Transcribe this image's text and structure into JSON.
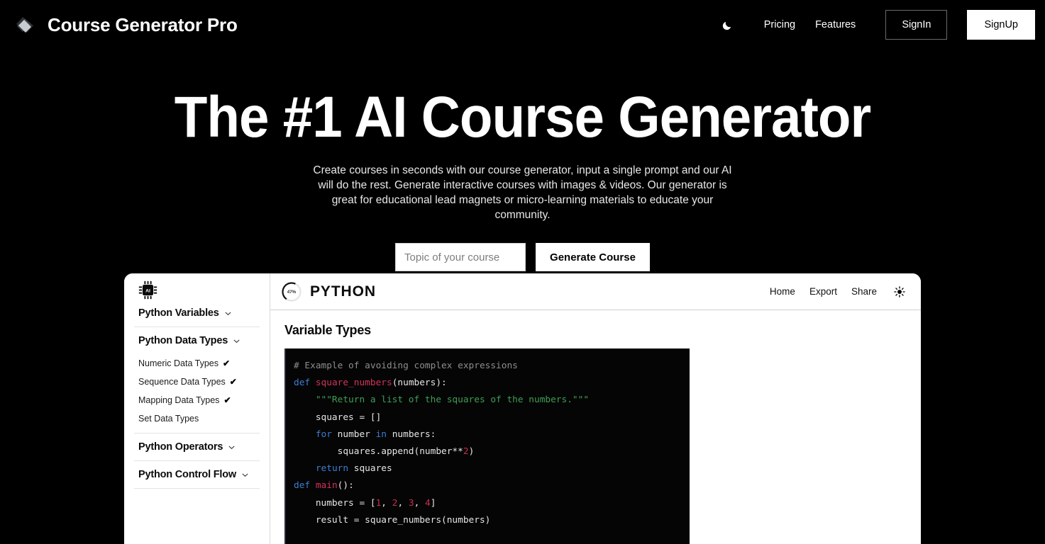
{
  "topnav": {
    "brand": "Course Generator Pro",
    "theme_icon": "moon-icon",
    "links": [
      "Pricing",
      "Features"
    ],
    "signin_label": "SignIn",
    "signup_label": "SignUp"
  },
  "hero": {
    "title": "The #1 AI Course Generator",
    "subtitle": "Create courses in seconds with our course generator, input a single prompt and our AI will do the rest. Generate interactive courses with images & videos. Our generator is great for educational lead magnets or micro-learning materials to educate your community.",
    "input_placeholder": "Topic of your course",
    "input_value": "",
    "generate_label": "Generate Course"
  },
  "preview": {
    "sidebar": {
      "logo_icon": "ai-chip-icon",
      "groups": [
        {
          "label": "Python Variables",
          "items": []
        },
        {
          "label": "Python Data Types",
          "items": [
            {
              "label": "Numeric Data Types",
              "done": true,
              "check": "✔"
            },
            {
              "label": "Sequence Data Types",
              "done": true,
              "check": "✔"
            },
            {
              "label": "Mapping Data Types",
              "done": true,
              "check": "✔"
            },
            {
              "label": "Set Data Types",
              "done": false,
              "check": ""
            }
          ]
        },
        {
          "label": "Python Operators",
          "items": []
        },
        {
          "label": "Python Control Flow",
          "items": []
        }
      ]
    },
    "header": {
      "progress_label": "47%",
      "course_title": "PYTHON",
      "links": [
        "Home",
        "Export",
        "Share"
      ],
      "theme_icon": "sun-icon"
    },
    "content": {
      "heading": "Variable Types",
      "code_lines": [
        [
          {
            "t": "# Example of avoiding complex expressions",
            "c": "com"
          }
        ],
        [
          {
            "t": "",
            "c": "pl"
          }
        ],
        [
          {
            "t": "def ",
            "c": "kw"
          },
          {
            "t": "square_numbers",
            "c": "fn"
          },
          {
            "t": "(numbers):",
            "c": "pl"
          }
        ],
        [
          {
            "t": "    \"\"\"Return a list of the squares of the numbers.\"\"\"",
            "c": "str"
          }
        ],
        [
          {
            "t": "    squares = []",
            "c": "pl"
          }
        ],
        [
          {
            "t": "    ",
            "c": "pl"
          },
          {
            "t": "for",
            "c": "kw"
          },
          {
            "t": " number ",
            "c": "pl"
          },
          {
            "t": "in",
            "c": "kw"
          },
          {
            "t": " numbers:",
            "c": "pl"
          }
        ],
        [
          {
            "t": "        squares.append(number**",
            "c": "pl"
          },
          {
            "t": "2",
            "c": "num"
          },
          {
            "t": ")",
            "c": "pl"
          }
        ],
        [
          {
            "t": "    ",
            "c": "pl"
          },
          {
            "t": "return",
            "c": "kw"
          },
          {
            "t": " squares",
            "c": "pl"
          }
        ],
        [
          {
            "t": "",
            "c": "pl"
          }
        ],
        [
          {
            "t": "def ",
            "c": "kw"
          },
          {
            "t": "main",
            "c": "fn"
          },
          {
            "t": "():",
            "c": "pl"
          }
        ],
        [
          {
            "t": "    numbers = [",
            "c": "pl"
          },
          {
            "t": "1",
            "c": "num"
          },
          {
            "t": ", ",
            "c": "pl"
          },
          {
            "t": "2",
            "c": "num"
          },
          {
            "t": ", ",
            "c": "pl"
          },
          {
            "t": "3",
            "c": "num"
          },
          {
            "t": ", ",
            "c": "pl"
          },
          {
            "t": "4",
            "c": "num"
          },
          {
            "t": "]",
            "c": "pl"
          }
        ],
        [
          {
            "t": "    result = square_numbers(numbers)",
            "c": "pl"
          }
        ]
      ]
    }
  },
  "colors": {
    "page_bg": "#000000",
    "panel_bg": "#ffffff",
    "code_bg": "#050505",
    "accent_keyword": "#3b7fd4",
    "accent_function": "#d2335c",
    "accent_string": "#3f9e55",
    "accent_number": "#c9304f",
    "accent_comment": "#8d8d8d"
  }
}
